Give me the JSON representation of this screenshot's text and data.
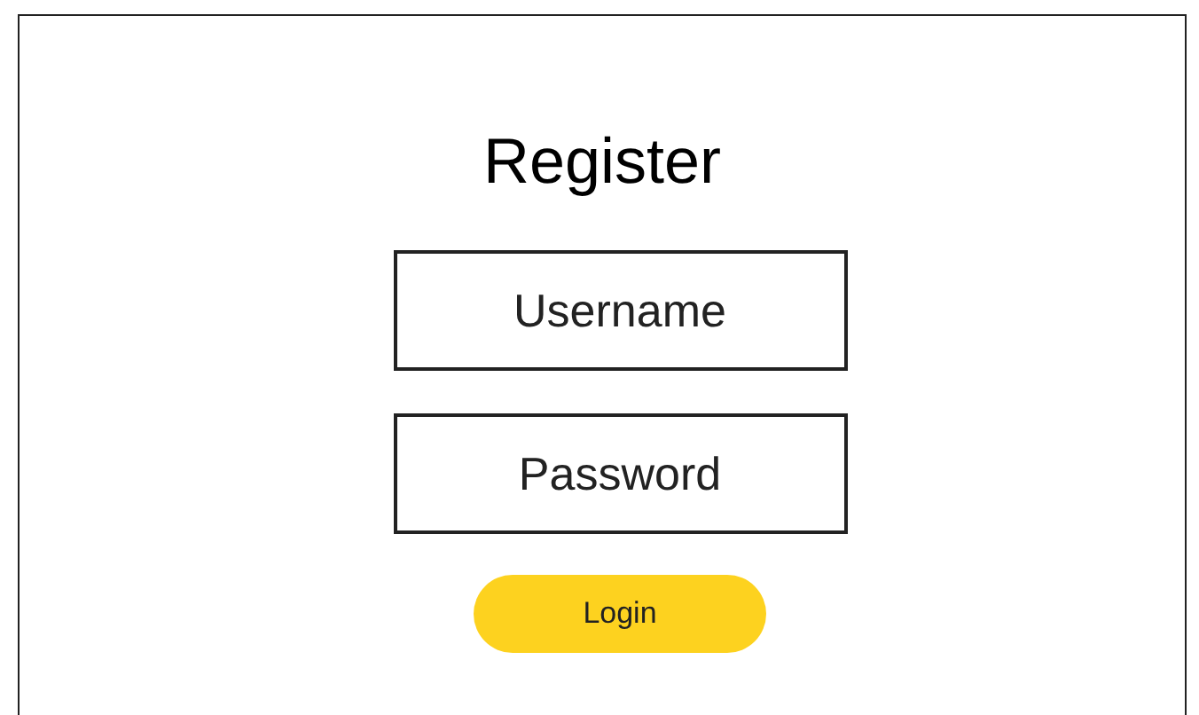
{
  "title": "Register",
  "fields": [
    {
      "placeholder": "Username"
    },
    {
      "placeholder": "Password"
    }
  ],
  "button": "Login"
}
